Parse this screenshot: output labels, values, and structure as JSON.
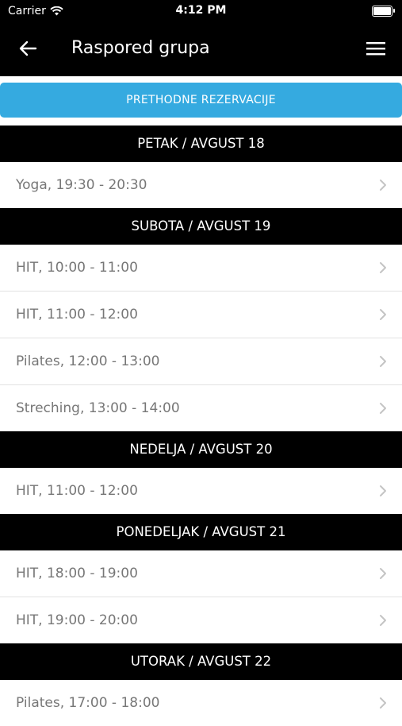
{
  "status_bar": {
    "carrier": "Carrier",
    "time": "4:12 PM"
  },
  "header": {
    "title": "Raspored grupa"
  },
  "prev_button": {
    "label": "PRETHODNE REZERVACIJE"
  },
  "days": [
    {
      "header": "PETAK / AVGUST 18",
      "items": [
        "Yoga, 19:30 - 20:30"
      ]
    },
    {
      "header": "SUBOTA / AVGUST 19",
      "items": [
        "HIT, 10:00 - 11:00",
        "HIT, 11:00 - 12:00",
        "Pilates, 12:00 - 13:00",
        "Streching, 13:00 - 14:00"
      ]
    },
    {
      "header": "NEDELJA / AVGUST 20",
      "items": [
        "HIT, 11:00 - 12:00"
      ]
    },
    {
      "header": "PONEDELJAK / AVGUST 21",
      "items": [
        "HIT, 18:00 - 19:00",
        "HIT, 19:00 - 20:00"
      ]
    },
    {
      "header": "UTORAK / AVGUST 22",
      "items": [
        "Pilates, 17:00 - 18:00"
      ]
    }
  ],
  "colors": {
    "accent": "#35aae0",
    "header_bg": "#000000",
    "row_text": "#777777"
  },
  "icons": [
    "wifi-icon",
    "battery-icon",
    "back-arrow-icon",
    "hamburger-menu-icon",
    "chevron-right-icon"
  ]
}
